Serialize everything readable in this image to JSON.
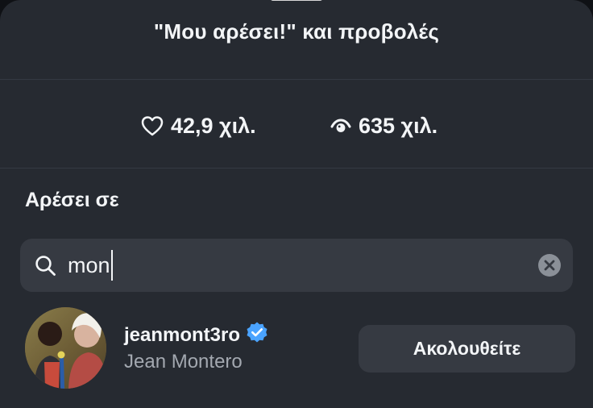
{
  "header": {
    "title": "\"Μου αρέσει!\" και προβολές"
  },
  "stats": {
    "likes": "42,9 χιλ.",
    "views": "635 χιλ.",
    "likes_icon": "heart-outline-icon",
    "views_icon": "eye-icon"
  },
  "likes_section": {
    "label": "Αρέσει σε"
  },
  "search": {
    "value": "mon",
    "search_icon": "search-icon",
    "clear_icon": "clear-icon"
  },
  "results": [
    {
      "username": "jeanmont3ro",
      "full_name": "Jean Montero",
      "verified": true,
      "verified_color": "#4aa3ff",
      "follow_label": "Ακολουθείτε"
    }
  ],
  "colors": {
    "sheet_background": "#262a31",
    "surface": "#363a42",
    "primary_text": "#f3f5f7",
    "secondary_text": "#a3a8b0"
  }
}
